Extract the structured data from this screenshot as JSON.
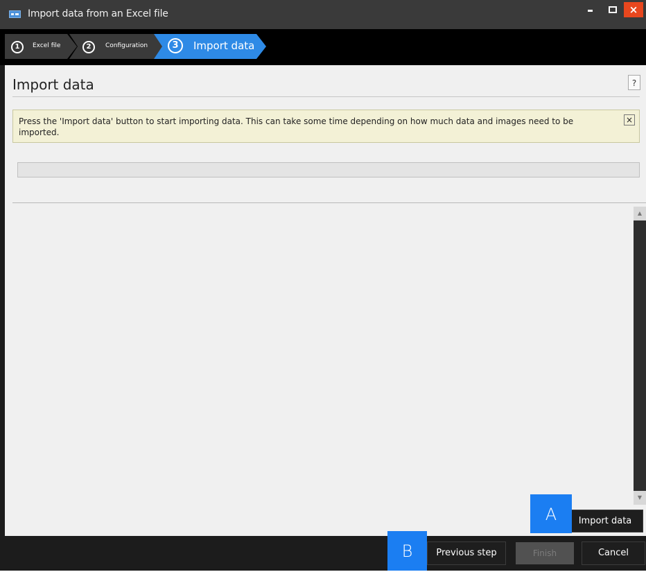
{
  "window": {
    "title": "Import data from an Excel file",
    "close_glyph": "×"
  },
  "steps": [
    {
      "number": "1",
      "label": "Excel file",
      "state": "completed"
    },
    {
      "number": "2",
      "label": "Configuration",
      "state": "completed"
    },
    {
      "number": "3",
      "label": "Import data",
      "state": "active"
    }
  ],
  "main": {
    "title": "Import data",
    "help_label": "?",
    "notice": {
      "text": "Press the 'Import data' button to start importing data. This can take some time depending on how much data and images need to be imported.",
      "close_glyph": "×"
    },
    "progress": 0
  },
  "buttons": {
    "import": "Import data",
    "previous": "Previous step",
    "finish": "Finish",
    "cancel": "Cancel"
  },
  "callouts": {
    "a": "A",
    "b": "B"
  },
  "colors": {
    "accent": "#1b7ef2",
    "step_active": "#2e8ae6",
    "step_inactive": "#3a3a3a",
    "close_button": "#e8471e",
    "notice_bg": "#f3f1d6"
  },
  "icons": {
    "app": "app-icon",
    "minimize": "minimize-icon",
    "maximize": "maximize-icon",
    "close": "close-icon",
    "help": "help-icon",
    "notice_close": "close-icon",
    "scroll_up": "scroll-up-arrow-icon",
    "scroll_down": "scroll-down-arrow-icon"
  }
}
